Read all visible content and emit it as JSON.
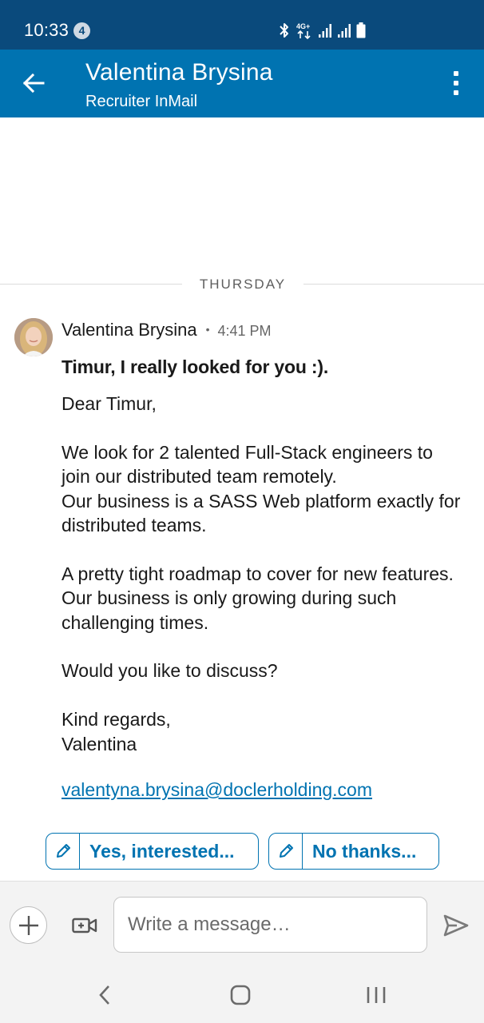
{
  "status_bar": {
    "time": "10:33",
    "notification_count": "4",
    "network_label": "4G+",
    "icons": [
      "bluetooth-icon",
      "network-4g-icon",
      "signal-icon",
      "signal-icon",
      "battery-icon"
    ]
  },
  "header": {
    "name": "Valentina Brysina",
    "subtitle": "Recruiter InMail",
    "color": "#0073b1",
    "status_color": "#0a4a7c"
  },
  "date_divider": "THURSDAY",
  "message": {
    "sender": "Valentina Brysina",
    "separator": "•",
    "time": "4:41 PM",
    "subject": "Timur, I really looked for you :).",
    "body": {
      "greeting": "Dear Timur,",
      "para1": "We look for 2 talented Full-Stack engineers to join our distributed team remotely.",
      "para2": "Our business is a SASS Web platform exactly for distributed teams.",
      "para3": "A pretty tight roadmap to cover for new features. Our business is only growing during such challenging times.",
      "question": "Would you like to discuss?",
      "closing": "Kind regards,",
      "signature": "Valentina"
    },
    "email": "valentyna.brysina@doclerholding.com"
  },
  "quick_replies": [
    {
      "label": "Yes, interested...",
      "icon": "pencil-icon"
    },
    {
      "label": "No thanks...",
      "icon": "pencil-icon"
    }
  ],
  "compose": {
    "placeholder": "Write a message…",
    "value": ""
  }
}
